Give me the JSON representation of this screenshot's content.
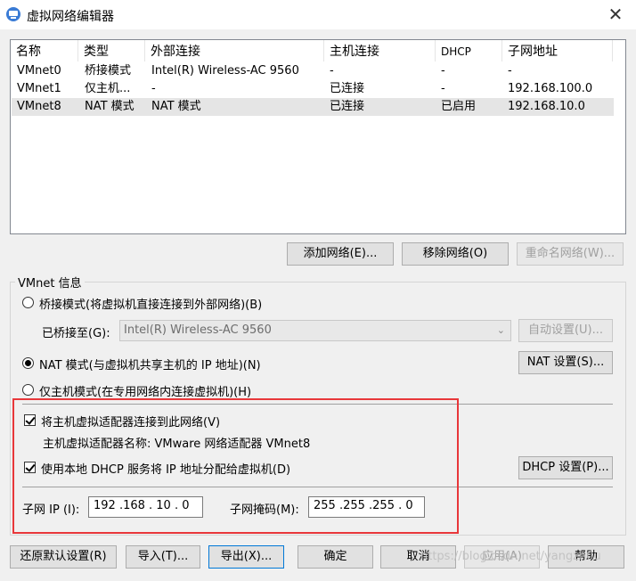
{
  "window": {
    "title": "虚拟网络编辑器",
    "app_icon": "vmware-network-icon",
    "close_label": "✕"
  },
  "table": {
    "headers": [
      "名称",
      "类型",
      "外部连接",
      "主机连接",
      "DHCP",
      "子网地址"
    ],
    "rows": [
      [
        "VMnet0",
        "桥接模式",
        "Intel(R) Wireless-AC 9560",
        "-",
        "-",
        "-"
      ],
      [
        "VMnet1",
        "仅主机...",
        "-",
        "已连接",
        "-",
        "192.168.100.0"
      ],
      [
        "VMnet8",
        "NAT 模式",
        "NAT 模式",
        "已连接",
        "已启用",
        "192.168.10.0"
      ]
    ],
    "selected_row": 2
  },
  "table_buttons": {
    "add": "添加网络(E)...",
    "remove": "移除网络(O)",
    "rename": "重命名网络(W)..."
  },
  "vmnet_info": {
    "group_label": "VMnet 信息",
    "bridge_radio": "桥接模式(将虚拟机直接连接到外部网络)(B)",
    "bridged_to_label": "已桥接至(G):",
    "bridged_to_value": "Intel(R) Wireless-AC 9560",
    "auto_settings": "自动设置(U)...",
    "nat_radio": "NAT 模式(与虚拟机共享主机的 IP 地址)(N)",
    "nat_settings": "NAT 设置(S)...",
    "host_only_radio": "仅主机模式(在专用网络内连接虚拟机)(H)",
    "connect_adapter_check": "将主机虚拟适配器连接到此网络(V)",
    "adapter_name": "主机虚拟适配器名称: VMware 网络适配器 VMnet8",
    "dhcp_check": "使用本地 DHCP 服务将 IP 地址分配给虚拟机(D)",
    "dhcp_settings": "DHCP 设置(P)...",
    "subnet_ip_label": "子网 IP (I):",
    "subnet_ip_value": "192 .168 . 10  .  0",
    "subnet_mask_label": "子网掩码(M):",
    "subnet_mask_value": "255 .255 .255 .  0"
  },
  "bottom_buttons": {
    "restore": "还原默认设置(R)",
    "import": "导入(T)...",
    "export": "导出(X)...",
    "ok": "确定",
    "cancel": "取消",
    "apply": "应用(A)",
    "help": "帮助"
  },
  "watermark": "https://blog.csdn.net/yangzh0u",
  "colors": {
    "highlight_box": "#e8373a",
    "focus_border": "#0078d7"
  }
}
